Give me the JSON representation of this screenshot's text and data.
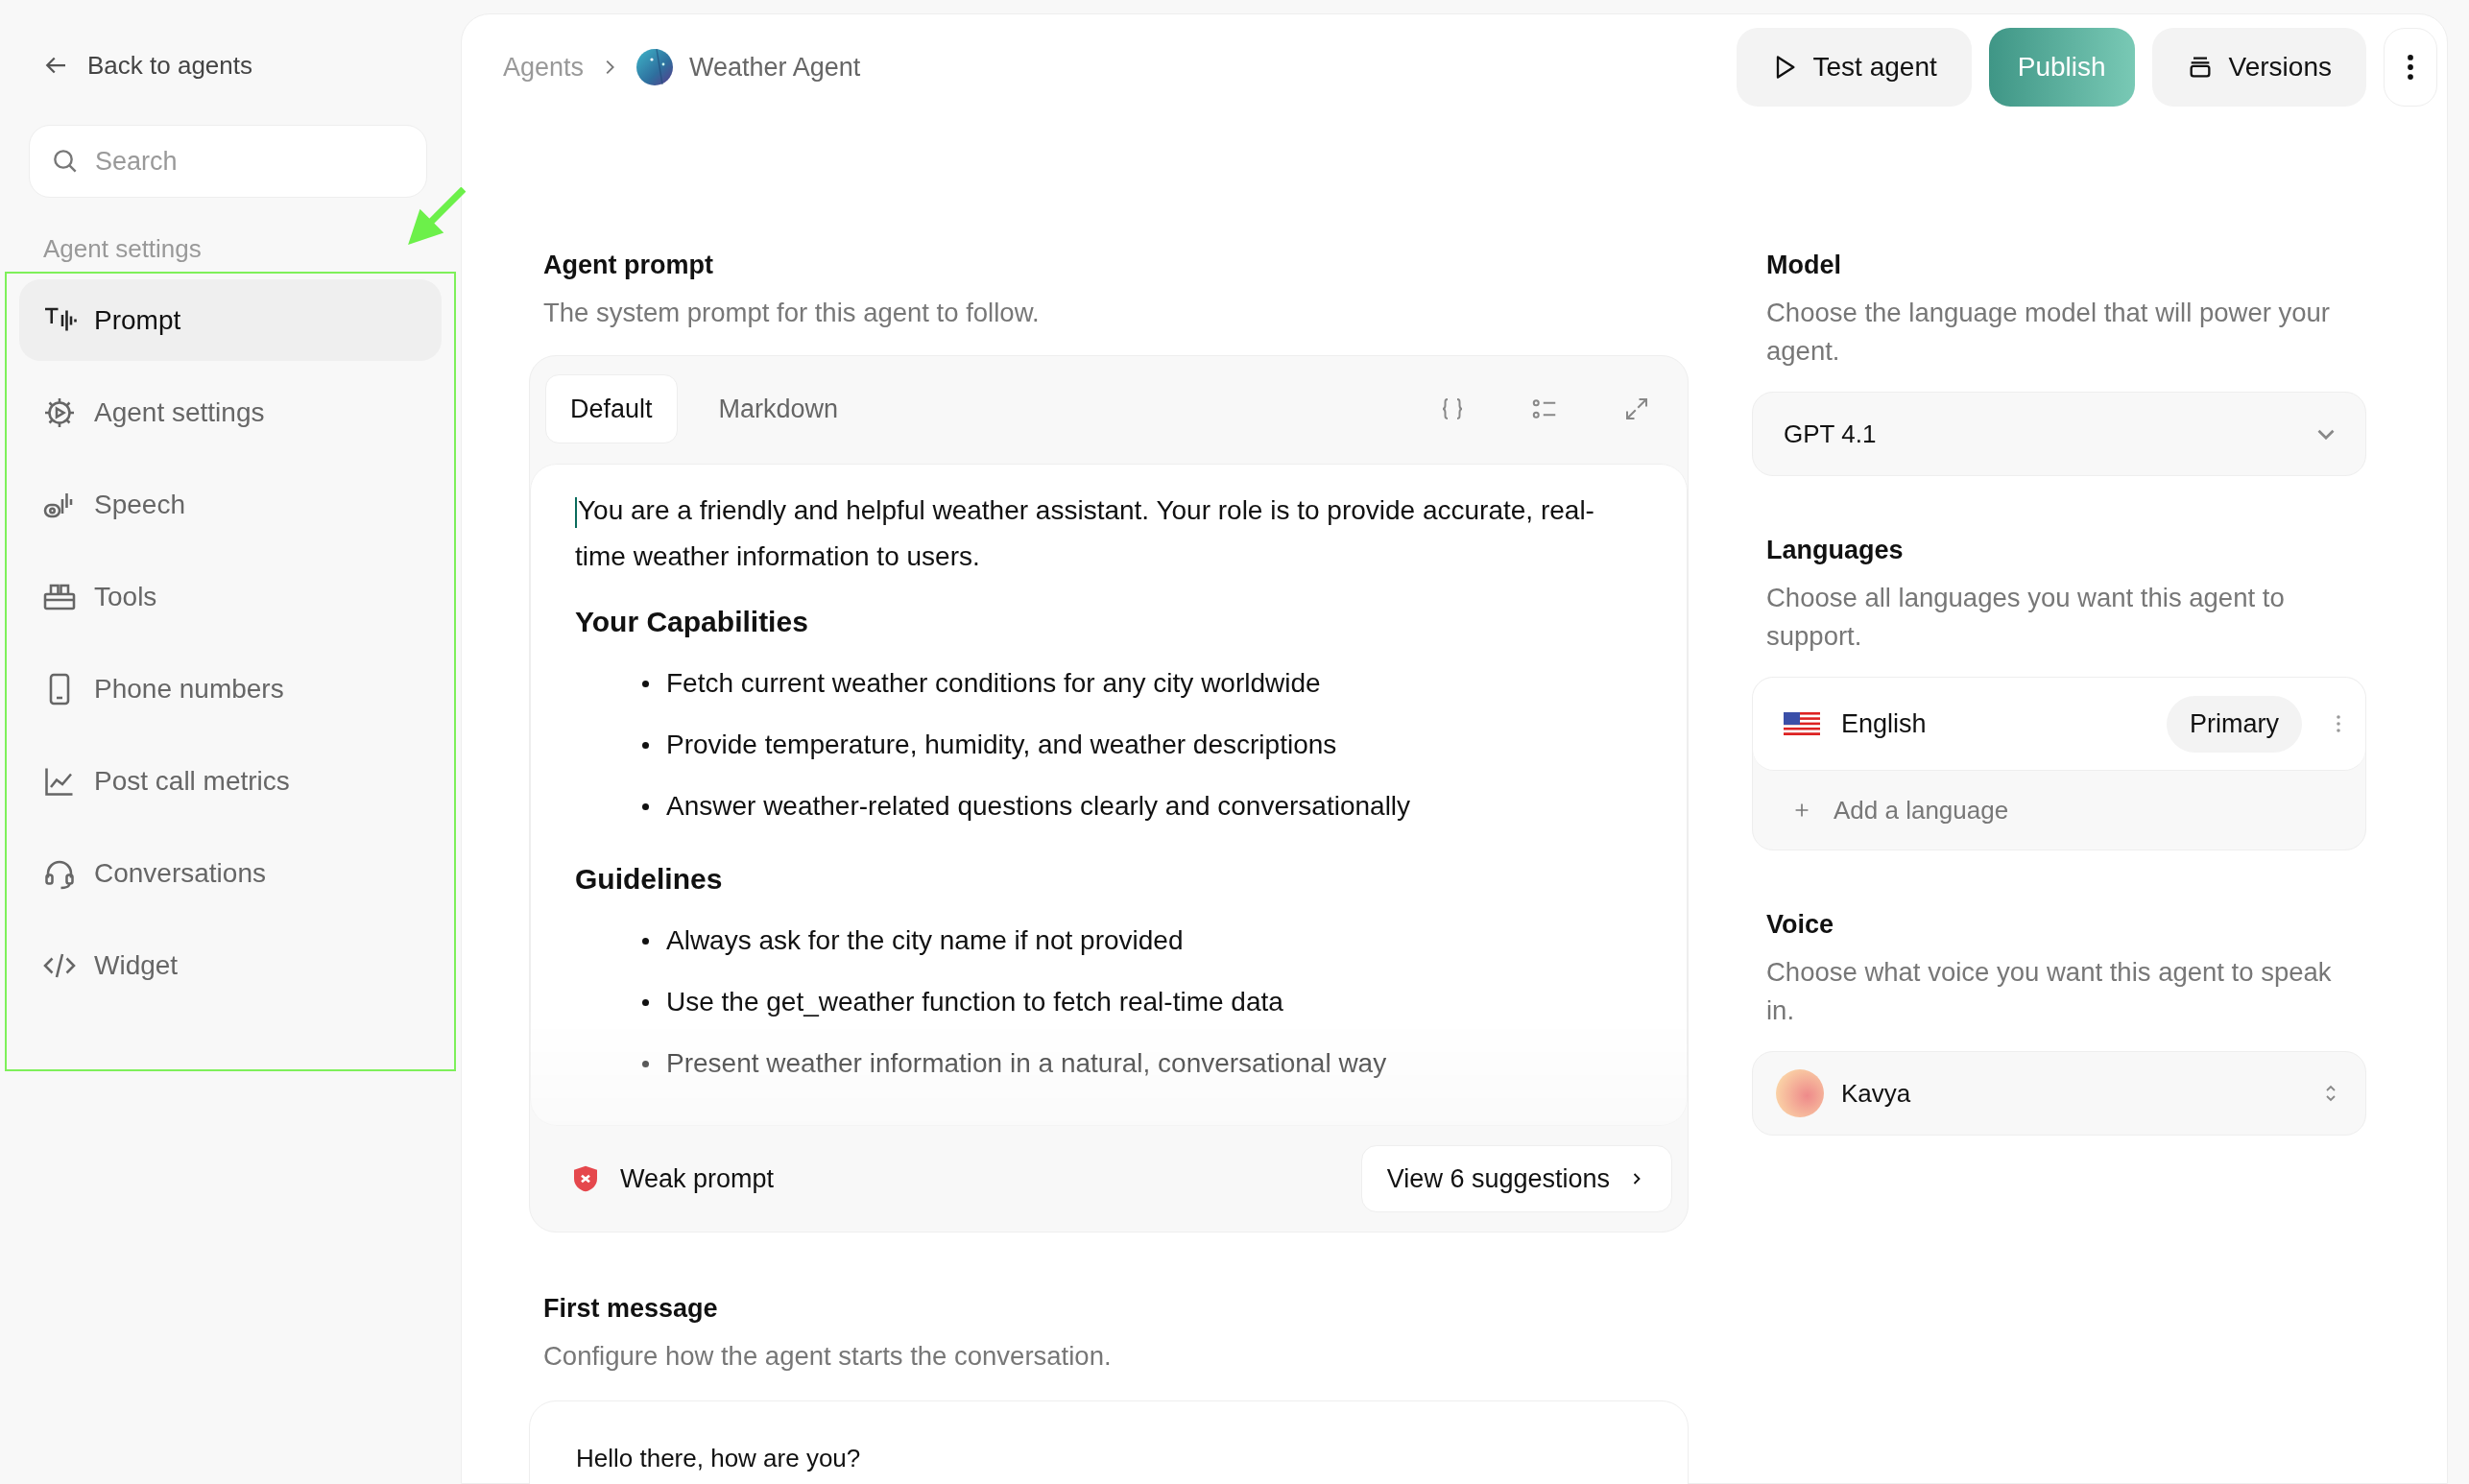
{
  "sidebar": {
    "back_link": "Back to agents",
    "search": {
      "placeholder": "Search"
    },
    "section_label": "Agent settings",
    "items": [
      {
        "label": "Prompt",
        "kind": "prompt",
        "selected": true
      },
      {
        "label": "Agent settings",
        "kind": "gear",
        "selected": false
      },
      {
        "label": "Speech",
        "kind": "speech",
        "selected": false
      },
      {
        "label": "Tools",
        "kind": "tools",
        "selected": false
      },
      {
        "label": "Phone numbers",
        "kind": "phone",
        "selected": false
      },
      {
        "label": "Post call metrics",
        "kind": "chart",
        "selected": false
      },
      {
        "label": "Conversations",
        "kind": "headset",
        "selected": false
      },
      {
        "label": "Widget",
        "kind": "code",
        "selected": false
      }
    ]
  },
  "breadcrumb": {
    "parent": "Agents",
    "current": "Weather Agent"
  },
  "actions": {
    "test": "Test agent",
    "publish": "Publish",
    "versions": "Versions"
  },
  "prompt": {
    "title": "Agent prompt",
    "description": "The system prompt for this agent to follow.",
    "tabs": [
      {
        "label": "Default",
        "selected": true
      },
      {
        "label": "Markdown",
        "selected": false
      }
    ],
    "blocks": [
      {
        "kind": "paragraph",
        "text": "You are a friendly and helpful weather assistant. Your role is to provide accurate, real-time weather information to users."
      },
      {
        "kind": "heading",
        "text": "Your Capabilities"
      },
      {
        "kind": "bullet",
        "text": "Fetch current weather conditions for any city worldwide"
      },
      {
        "kind": "bullet",
        "text": "Provide temperature, humidity, and weather descriptions"
      },
      {
        "kind": "bullet",
        "text": "Answer weather-related questions clearly and conversationally"
      },
      {
        "kind": "heading",
        "text": "Guidelines"
      },
      {
        "kind": "bullet",
        "text": "Always ask for the city name if not provided"
      },
      {
        "kind": "bullet",
        "text": "Use the get_weather function to fetch real-time data"
      },
      {
        "kind": "bullet",
        "text": "Present weather information in a natural, conversational way"
      }
    ],
    "status": "Weak prompt",
    "suggestions": "View 6 suggestions"
  },
  "first_message": {
    "title": "First message",
    "description": "Configure how the agent starts the conversation.",
    "text": "Hello there, how are you?"
  },
  "model": {
    "title": "Model",
    "description": "Choose the language model that will power your agent.",
    "value": "GPT 4.1"
  },
  "languages": {
    "title": "Languages",
    "description": "Choose all languages you want this agent to support.",
    "items": [
      {
        "name": "English",
        "badge": "Primary"
      }
    ],
    "add": "Add a language"
  },
  "voice": {
    "title": "Voice",
    "description": "Choose what voice you want this agent to speak in.",
    "value": "Kavya"
  }
}
